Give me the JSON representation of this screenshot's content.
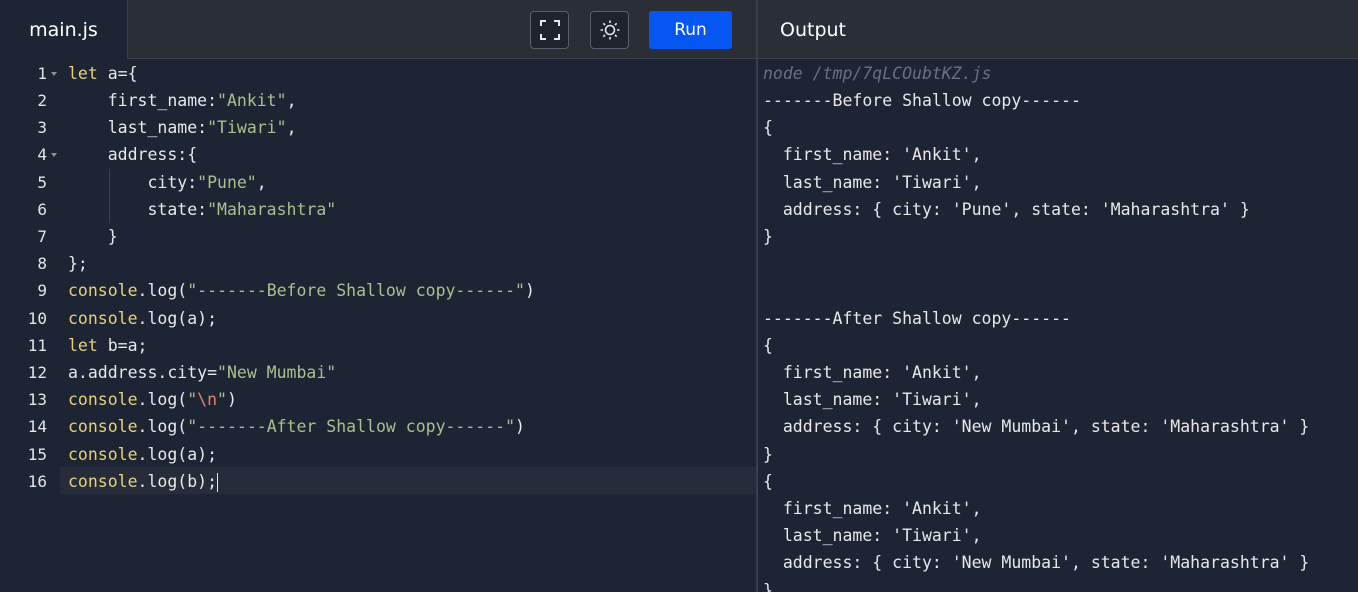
{
  "editor": {
    "tab": "main.js",
    "line_numbers": [
      "1",
      "2",
      "3",
      "4",
      "5",
      "6",
      "7",
      "8",
      "9",
      "10",
      "11",
      "12",
      "13",
      "14",
      "15",
      "16"
    ],
    "fold_lines": [
      "1",
      "4"
    ],
    "code": {
      "l1_kw": "let",
      "l1_rest": " a={",
      "l2_key": "    first_name:",
      "l2_str": "\"Ankit\"",
      "l2_end": ",",
      "l3_key": "    last_name:",
      "l3_str": "\"Tiwari\"",
      "l3_end": ",",
      "l4": "    address:{",
      "l5_key": "        city:",
      "l5_str": "\"Pune\"",
      "l5_end": ",",
      "l6_key": "        state:",
      "l6_str": "\"Maharashtra\"",
      "l7": "    }",
      "l8": "};",
      "l9_kw": "console",
      "l9_mid": ".log(",
      "l9_str": "\"-------Before Shallow copy------\"",
      "l9_end": ")",
      "l10_kw": "console",
      "l10_rest": ".log(a);",
      "l11_kw": "let",
      "l11_rest": " b=a;",
      "l12_pre": "a.address.city=",
      "l12_str": "\"New Mumbai\"",
      "l13_kw": "console",
      "l13_mid": ".log(",
      "l13_q1": "\"",
      "l13_esc": "\\n",
      "l13_q2": "\"",
      "l13_end": ")",
      "l14_kw": "console",
      "l14_mid": ".log(",
      "l14_str": "\"-------After Shallow copy------\"",
      "l14_end": ")",
      "l15_kw": "console",
      "l15_rest": ".log(a);",
      "l16_kw": "console",
      "l16_rest": ".log(b);"
    }
  },
  "toolbar": {
    "fullscreen_icon": "fullscreen-icon",
    "theme_icon": "sun-icon",
    "run_label": "Run"
  },
  "output": {
    "header": "Output",
    "lines": [
      "node /tmp/7qLCOubtKZ.js",
      "-------Before Shallow copy------",
      "{",
      "  first_name: 'Ankit',",
      "  last_name: 'Tiwari',",
      "  address: { city: 'Pune', state: 'Maharashtra' }",
      "}",
      "",
      "",
      "-------After Shallow copy------",
      "{",
      "  first_name: 'Ankit',",
      "  last_name: 'Tiwari',",
      "  address: { city: 'New Mumbai', state: 'Maharashtra' }",
      "}",
      "{",
      "  first_name: 'Ankit',",
      "  last_name: 'Tiwari',",
      "  address: { city: 'New Mumbai', state: 'Maharashtra' }",
      "}"
    ]
  },
  "colors": {
    "run_button": "#0556f3",
    "background": "#1d2433",
    "keyword": "#e6d27a",
    "string": "#a8c18d"
  }
}
